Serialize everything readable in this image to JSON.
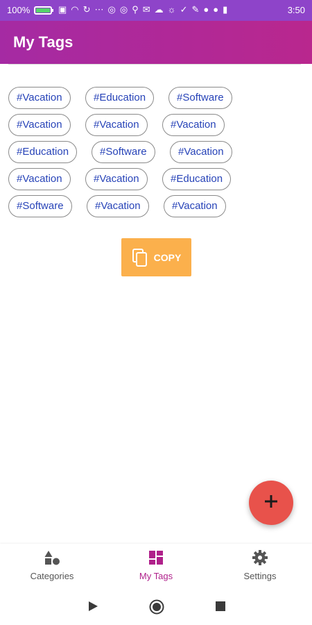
{
  "status_bar": {
    "battery_percent": "100%",
    "time": "3:50",
    "icons": [
      "battery-icon",
      "cast-icon",
      "wifi-icon",
      "sync-off-icon",
      "more-icon",
      "instagram-icon",
      "instagram-icon",
      "location-icon",
      "mail-icon",
      "cloud-icon",
      "brightness-icon",
      "check-icon",
      "pencil-icon",
      "facebook-icon",
      "facebook-icon",
      "trash-icon"
    ]
  },
  "app_bar": {
    "title": "My Tags"
  },
  "tags": [
    [
      "#Vacation",
      "#Education",
      "#Software"
    ],
    [
      "#Vacation",
      "#Vacation",
      "#Vacation"
    ],
    [
      "#Education",
      "#Software",
      "#Vacation"
    ],
    [
      "#Vacation",
      "#Vacation",
      "#Education"
    ],
    [
      "#Software",
      "#Vacation",
      "#Vacation"
    ]
  ],
  "copy_button": {
    "label": "COPY",
    "color": "#fbb04c"
  },
  "fab": {
    "label": "+",
    "color": "#e8524b"
  },
  "bottom_nav": {
    "items": [
      {
        "label": "Categories",
        "icon": "categories-shapes-icon",
        "active": false
      },
      {
        "label": "My Tags",
        "icon": "dashboard-grid-icon",
        "active": true
      },
      {
        "label": "Settings",
        "icon": "gear-icon",
        "active": false
      }
    ],
    "active_color": "#b0218b"
  },
  "system_nav": {
    "buttons": [
      "back-play-icon",
      "home-circle-icon",
      "recents-square-icon"
    ]
  }
}
